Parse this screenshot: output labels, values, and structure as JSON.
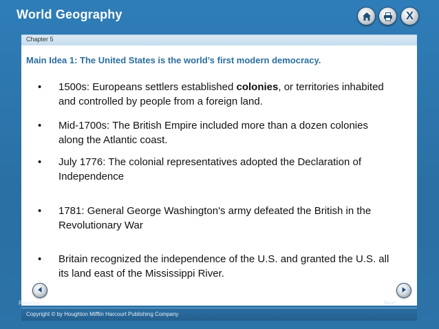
{
  "app": {
    "title": "World Geography"
  },
  "toolbar": {
    "home_icon": "home-icon",
    "print_icon": "printer-icon",
    "close_label": "X"
  },
  "chapter": {
    "label": "Chapter 5"
  },
  "main_idea": "Main Idea 1: The United States is the world’s first modern democracy.",
  "bullets": [
    {
      "pre": "1500s: Europeans settlers established ",
      "bold": "colonies",
      "post": ", or territories inhabited and controlled by people from a foreign land."
    },
    {
      "pre": "Mid-1700s: The British Empire included more than a dozen colonies along the Atlantic coast.",
      "bold": "",
      "post": ""
    },
    {
      "pre": "July 1776: The colonial representatives adopted the Declaration of Independence",
      "bold": "",
      "post": ""
    },
    {
      "pre": "1781: General George Washington's army defeated the British in the Revolutionary War",
      "bold": "",
      "post": ""
    },
    {
      "pre": "Britain recognized the independence of the U.S. and granted the U.S. all its land east of the Mississippi River.",
      "bold": "",
      "post": ""
    }
  ],
  "nav": {
    "previous": "Previous",
    "next": "Next"
  },
  "footer": {
    "copyright": "Copyright © by Houghton Mifflin Harcourt Publishing Company"
  },
  "colors": {
    "accent": "#2b6e9e",
    "frame": "#2a72a8",
    "panel": "#ffffff"
  }
}
